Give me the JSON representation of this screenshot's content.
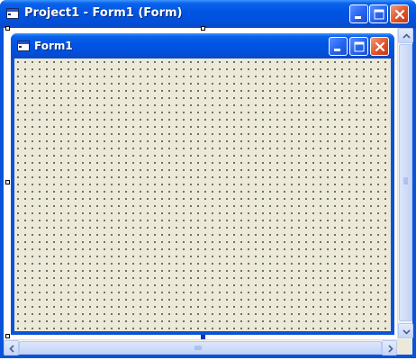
{
  "outer_window": {
    "title": "Project1 - Form1 (Form)",
    "icon": "form-icon",
    "buttons": {
      "minimize": "minimize-icon",
      "maximize": "maximize-icon",
      "close": "close-icon"
    }
  },
  "form_window": {
    "title": "Form1",
    "icon": "form-icon",
    "buttons": {
      "minimize": "minimize-icon",
      "maximize": "maximize-icon",
      "close": "close-icon"
    }
  },
  "colors": {
    "titlebar_blue": "#0054e3",
    "close_red": "#e0542c",
    "form_background": "#ece9d8",
    "grid_dot": "#000000"
  }
}
